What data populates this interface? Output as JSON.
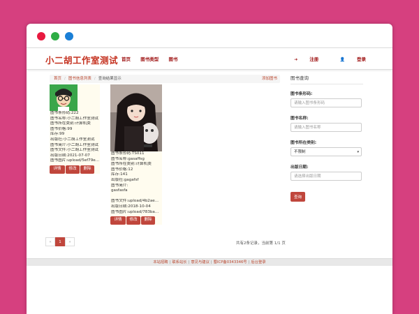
{
  "navbar": {
    "brand": "小二胡工作室测试",
    "links": [
      "首页",
      "图书类型",
      "图书"
    ],
    "register": "注册",
    "login": "登录"
  },
  "breadcrumb": {
    "home": "首页",
    "list": "图书信息列表",
    "current": "查询结果显示",
    "add": "添加图书"
  },
  "books": [
    {
      "lines": [
        "图书条形码:222",
        "图书名称:小二胡工作室测试",
        "图书所在类别:计算机类",
        "图书价格:99",
        "库存:99",
        "出版社:小二胡工作室测试",
        "图书简介:小二胡工作室测试",
        "图书文件:小二胡工作室测试",
        "出版日期:2021-07-07",
        "图书图片:upload/5ef79e..."
      ]
    },
    {
      "lines": [
        "图书条形码:TS011",
        "图书名称:gasaffsg",
        "图书所在类别:计算机类",
        "图书价格:12",
        "库存:141",
        "出版社:gagafsf",
        "图书简介:",
        "gasfasfa",
        "",
        "图书文件:upload/4b2ae...",
        "出版日期:2018-10-04",
        "图书图片:upload/783ba..."
      ]
    }
  ],
  "buttons": {
    "detail": "详情",
    "edit": "修改",
    "delete": "删除"
  },
  "sidebar": {
    "title": "图书查询",
    "barcode_label": "图书条形码:",
    "barcode_placeholder": "请输入图书条形码",
    "name_label": "图书名称:",
    "name_placeholder": "请输入图书名称",
    "category_label": "图书所在类别:",
    "category_value": "不限制",
    "date_label": "出版日期:",
    "date_placeholder": "请选择出版日期",
    "search": "查询"
  },
  "pager": {
    "prev": "«",
    "current": "1",
    "next": "»",
    "info": "共有2条记录，当前第 1/1 页"
  },
  "footer": {
    "links": [
      "本站招聘",
      "联系站长",
      "意见与建议",
      "蜀ICP备0343346号",
      "后台登录"
    ]
  },
  "colors": {
    "background": "#d6407f",
    "accent": "#c0463c",
    "brand": "#c4301e"
  }
}
